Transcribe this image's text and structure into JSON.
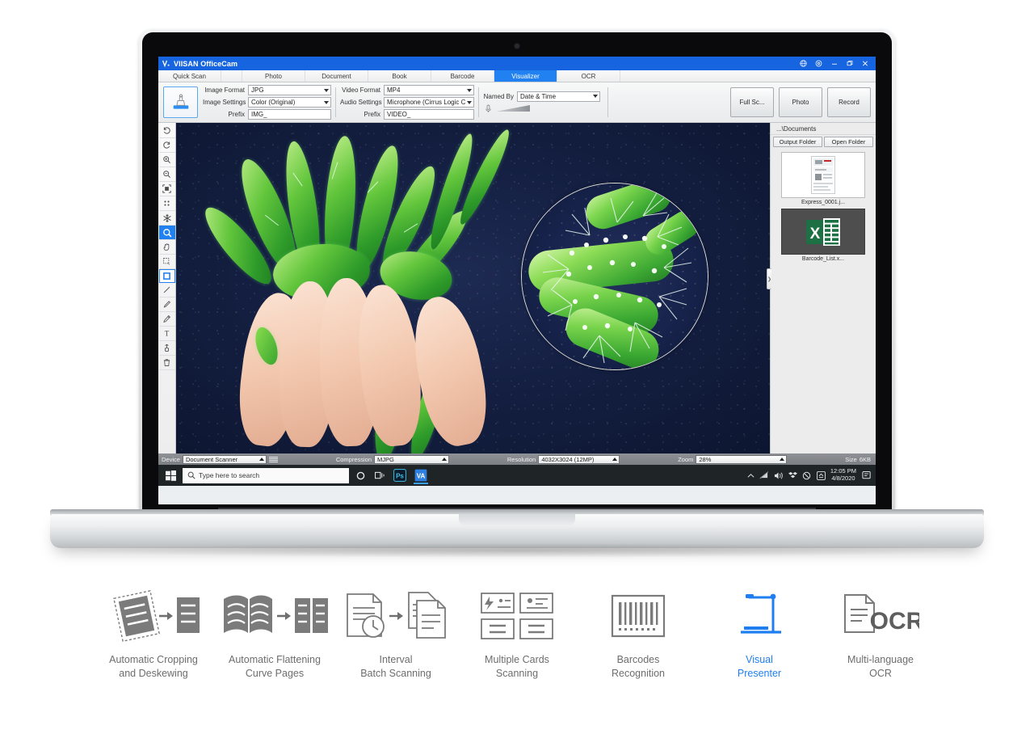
{
  "app": {
    "title": "VIISAN OfficeCam",
    "logo_icon": "viisan-logo-icon",
    "titlebar_icons": [
      "globe-icon",
      "gear-icon",
      "minimize-icon",
      "restore-icon",
      "close-icon"
    ]
  },
  "tabs": [
    {
      "label": "Quick Scan",
      "active": false
    },
    {
      "label": "",
      "active": false,
      "separator": true
    },
    {
      "label": "Photo",
      "active": false
    },
    {
      "label": "Document",
      "active": false
    },
    {
      "label": "Book",
      "active": false
    },
    {
      "label": "Barcode",
      "active": false
    },
    {
      "label": "Visualizer",
      "active": true
    },
    {
      "label": "OCR",
      "active": false
    }
  ],
  "settings": {
    "preview_button_name": "camera-preview-button",
    "image_group": [
      {
        "label": "Image Format",
        "value": "JPG",
        "type": "select"
      },
      {
        "label": "Image Settings",
        "value": "Color (Original)",
        "type": "select"
      },
      {
        "label": "Prefix",
        "value": "IMG_",
        "type": "text"
      }
    ],
    "video_group": [
      {
        "label": "Video Format",
        "value": "MP4",
        "type": "select"
      },
      {
        "label": "Audio Settings",
        "value": "Microphone (Cirrus Logic Ct",
        "type": "select"
      },
      {
        "label": "Prefix",
        "value": "VIDEO_",
        "type": "text"
      }
    ],
    "named_by": {
      "label": "Named By",
      "value": "Date & Time"
    },
    "mic_icon": "microphone-icon",
    "actions": [
      {
        "label": "Full Sc...",
        "name": "full-screen-button"
      },
      {
        "label": "Photo",
        "name": "photo-button"
      },
      {
        "label": "Record",
        "name": "record-button"
      }
    ]
  },
  "tools": [
    {
      "name": "rotate-left-icon",
      "selected": false
    },
    {
      "name": "rotate-right-icon",
      "selected": false
    },
    {
      "name": "zoom-in-icon",
      "selected": false
    },
    {
      "name": "zoom-out-icon",
      "selected": false
    },
    {
      "name": "fit-screen-icon",
      "selected": false
    },
    {
      "name": "four-dots-icon",
      "selected": false
    },
    {
      "name": "freeze-snowflake-icon",
      "selected": false
    },
    {
      "name": "magnifier-icon",
      "selected": true
    },
    {
      "name": "pan-hand-icon",
      "selected": false
    },
    {
      "name": "select-region-icon",
      "selected": false
    },
    {
      "name": "rectangle-shape-icon",
      "selected": false,
      "outlined": true
    },
    {
      "name": "line-tool-icon",
      "selected": false
    },
    {
      "name": "highlighter-icon",
      "selected": false
    },
    {
      "name": "pencil-icon",
      "selected": false
    },
    {
      "name": "text-tool-icon",
      "selected": false
    },
    {
      "name": "eraser-icon",
      "selected": false
    },
    {
      "name": "delete-trash-icon",
      "selected": false
    }
  ],
  "panel": {
    "path": "...\\Documents",
    "buttons": [
      {
        "label": "Output Folder",
        "name": "output-folder-button"
      },
      {
        "label": "Open Folder",
        "name": "open-folder-button"
      }
    ],
    "files": [
      {
        "label": "Express_0001.j...",
        "kind": "image-thumbnail"
      },
      {
        "label": "Barcode_List.x...",
        "kind": "excel-file-icon"
      }
    ],
    "collapse_handle_icon": "chevron-right-icon"
  },
  "statusbar": {
    "device": {
      "label": "Device",
      "value": "Document Scanner"
    },
    "sliders_icon": "sliders-icon",
    "compression": {
      "label": "Compression",
      "value": "MJPG"
    },
    "resolution": {
      "label": "Resolution",
      "value": "4032X3024 (12MP)"
    },
    "zoom": {
      "label": "Zoom",
      "value": "28%"
    },
    "size": {
      "label": "Size",
      "value": "6KB"
    }
  },
  "taskbar": {
    "start_icon": "windows-start-icon",
    "search_placeholder": "Type here to search",
    "search_icon": "search-icon",
    "cortana_icon": "cortana-circle-icon",
    "task_view_icon": "task-view-icon",
    "apps": [
      {
        "name": "photoshop-app-icon",
        "label": "Ps",
        "active": false
      },
      {
        "name": "viisan-app-icon",
        "label": "VA",
        "active": true
      }
    ],
    "tray_icons": [
      "chevron-up-icon",
      "network-icon",
      "volume-icon",
      "dropbox-icon",
      "shield-icon",
      "action-center-icon"
    ],
    "clock_time": "12:05 PM",
    "clock_date": "4/8/2020",
    "notification_icon": "notifications-icon"
  },
  "features": [
    {
      "icon": "auto-crop-deskew-icon",
      "line1": "Automatic Cropping",
      "line2": "and Deskewing",
      "accent": false
    },
    {
      "icon": "auto-flatten-curve-icon",
      "line1": "Automatic Flattening",
      "line2": "Curve Pages",
      "accent": false
    },
    {
      "icon": "interval-batch-scan-icon",
      "line1": "Interval",
      "line2": "Batch Scanning",
      "accent": false
    },
    {
      "icon": "multiple-cards-icon",
      "line1": "Multiple Cards",
      "line2": "Scanning",
      "accent": false
    },
    {
      "icon": "barcode-icon",
      "line1": "Barcodes",
      "line2": "Recognition",
      "accent": false
    },
    {
      "icon": "visual-presenter-icon",
      "line1": "Visual",
      "line2": "Presenter",
      "accent": true
    },
    {
      "icon": "ocr-document-icon",
      "line1": "Multi-language",
      "line2": "OCR",
      "accent": false
    }
  ],
  "colors": {
    "titlebar_blue": "#1664e0",
    "tab_active_blue": "#2181f0",
    "accent_blue": "#1f7ff0",
    "feature_gray": "#6d6d6d",
    "statusbar_gray": "#8e9195",
    "taskbar_dark": "#1f2427"
  }
}
